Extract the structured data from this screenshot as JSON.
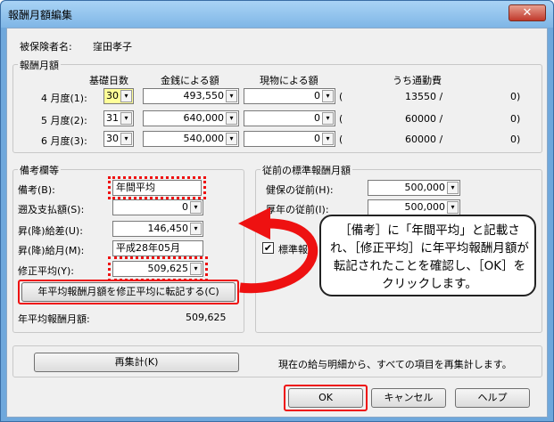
{
  "window": {
    "title": "報酬月額編集",
    "close_label": "✕"
  },
  "insured": {
    "label": "被保険者名:",
    "name": "窪田孝子"
  },
  "monthly": {
    "group_title": "報酬月額",
    "headers": {
      "days": "基礎日数",
      "cash": "金銭による額",
      "kind": "現物による額",
      "commute": "うち通勤費"
    },
    "rows": [
      {
        "label": "4 月度(1):",
        "days": "30",
        "cash": "493,550",
        "kind": "0",
        "open": "(",
        "commute": "13550 /",
        "close": "0)"
      },
      {
        "label": "5 月度(2):",
        "days": "31",
        "cash": "640,000",
        "kind": "0",
        "open": "(",
        "commute": "60000 /",
        "close": "0)"
      },
      {
        "label": "6 月度(3):",
        "days": "30",
        "cash": "540,000",
        "kind": "0",
        "open": "(",
        "commute": "60000 /",
        "close": "0)"
      }
    ]
  },
  "remarks": {
    "group_title": "備考欄等",
    "bikou_label": "備考(B):",
    "bikou_value": "年間平均",
    "sokyu_label": "遡及支払額(S):",
    "sokyu_value": "0",
    "shokyu_label": "昇(降)給差(U):",
    "shokyu_value": "146,450",
    "shokyu_month_label": "昇(降)給月(M):",
    "shokyu_month_value": "平成28年05月",
    "shusei_label": "修正平均(Y):",
    "shusei_value": "509,625",
    "transfer_button": "年平均報酬月額を修正平均に転記する(C)",
    "annual_label": "年平均報酬月額:",
    "annual_value": "509,625"
  },
  "previous": {
    "group_title": "従前の標準報酬月額",
    "kenpo_label": "健保の従前(H):",
    "kenpo_value": "500,000",
    "kosei_label": "厚年の従前(I):",
    "kosei_value": "500,000",
    "checkbox_label": "標準報酬"
  },
  "callout": {
    "text": "［備考］に「年間平均」と記載され、［修正平均］に年平均報酬月額が転記されたことを確認し、［OK］をクリックします。"
  },
  "recalc": {
    "button": "再集計(K)",
    "note": "現在の給与明細から、すべての項目を再集計します。"
  },
  "footer": {
    "ok": "OK",
    "cancel": "キャンセル",
    "help": "ヘルプ"
  },
  "icons": {
    "dropdown": "▾",
    "check": "✔"
  }
}
